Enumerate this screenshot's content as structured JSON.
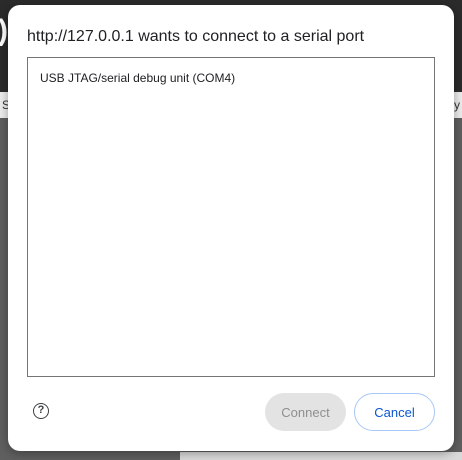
{
  "dialog": {
    "title": "http://127.0.0.1 wants to connect to a serial port",
    "devices": [
      {
        "label": "USB JTAG/serial debug unit (COM4)"
      }
    ],
    "help_icon": "help-circle-icon",
    "connect_label": "Connect",
    "connect_enabled": false,
    "cancel_label": "Cancel",
    "accent_color": "#0b57d0"
  },
  "background": {
    "left_glyph": ")",
    "left_text": "S",
    "right_text": "y"
  }
}
